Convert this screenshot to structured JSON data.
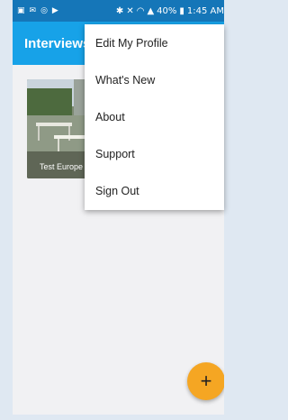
{
  "status_bar": {
    "battery": "40%",
    "time": "1:45 AM"
  },
  "app_bar": {
    "title": "Interviews"
  },
  "cards": [
    {
      "caption": "Test Europe Office"
    }
  ],
  "overflow_menu": {
    "items": [
      {
        "label": "Edit My Profile"
      },
      {
        "label": "What's New"
      },
      {
        "label": "About"
      },
      {
        "label": "Support"
      },
      {
        "label": "Sign Out"
      }
    ]
  },
  "fab": {
    "label": "+",
    "icon": "plus-icon",
    "color": "#f5a623"
  },
  "colors": {
    "status_bar": "#1576b8",
    "app_bar": "#17a2e8",
    "background": "#f1f1f3"
  }
}
